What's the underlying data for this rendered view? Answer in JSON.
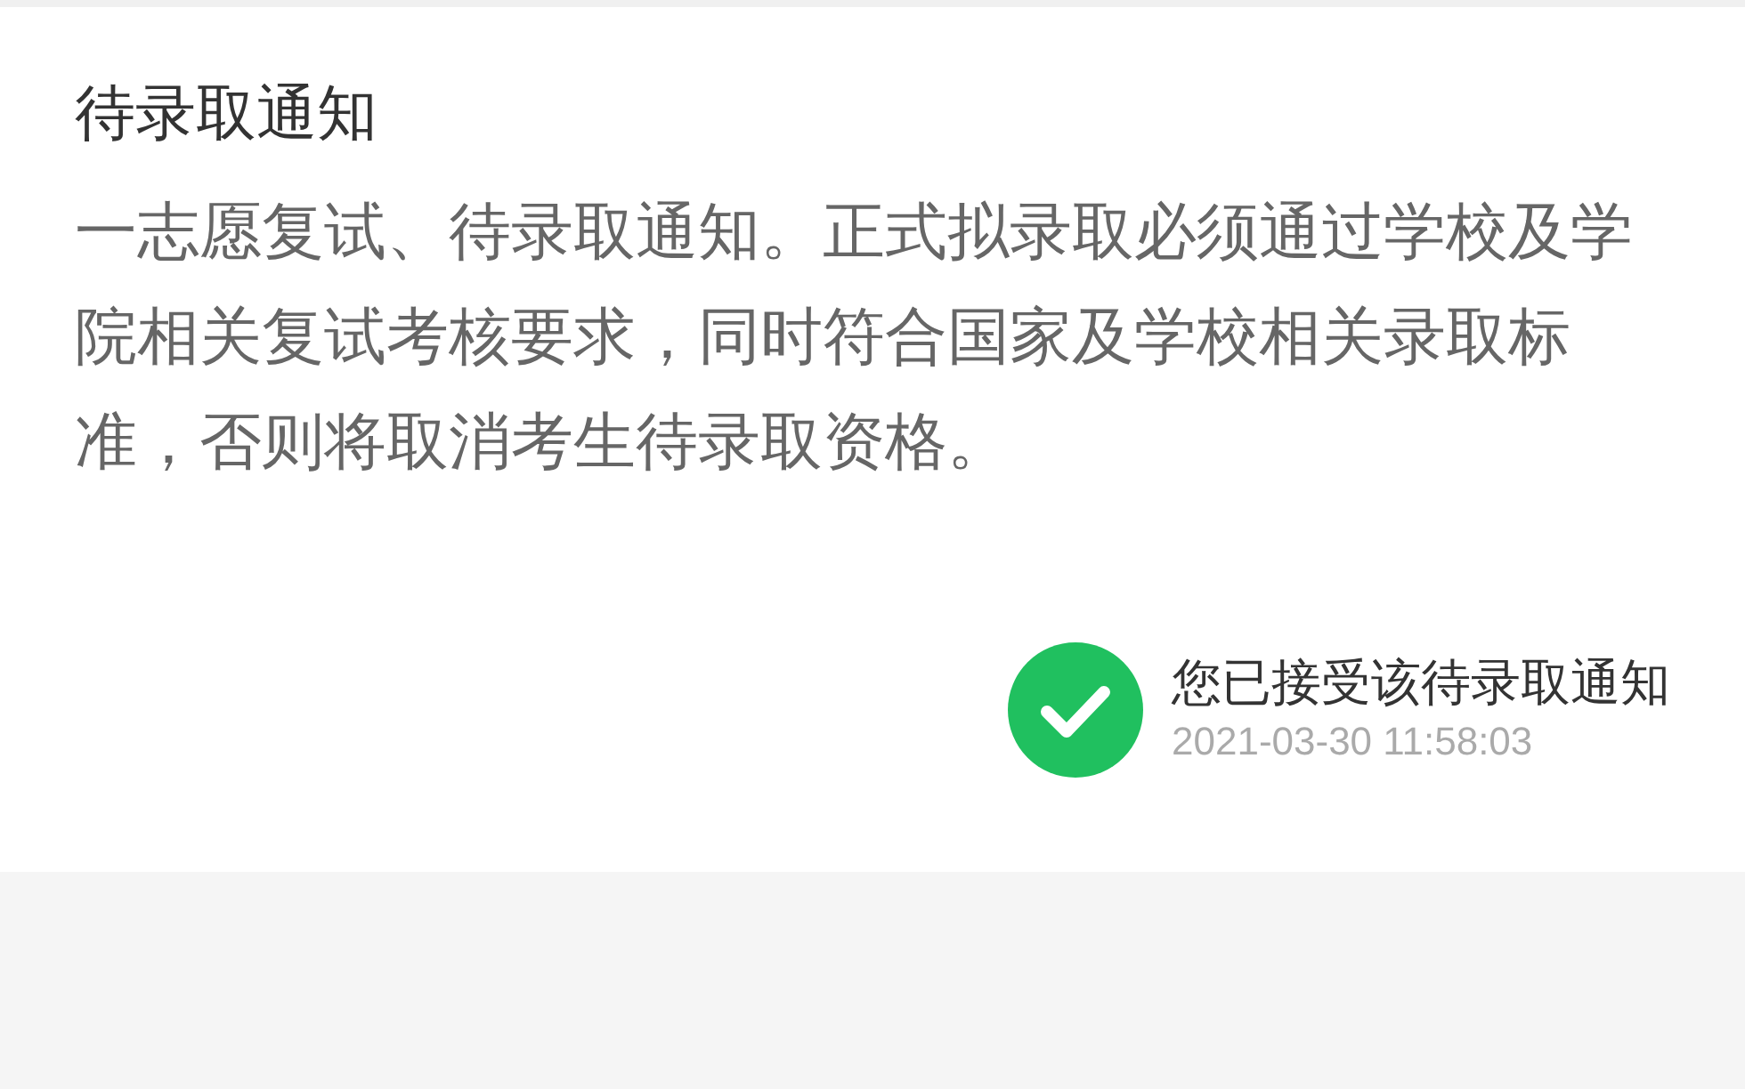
{
  "notice": {
    "title": "待录取通知",
    "body": "一志愿复试、待录取通知。正式拟录取必须通过学校及学院相关复试考核要求，同时符合国家及学校相关录取标准，否则将取消考生待录取资格。"
  },
  "status": {
    "accepted": true,
    "text": "您已接受该待录取通知",
    "time": "2021-03-30 11:58:03"
  }
}
